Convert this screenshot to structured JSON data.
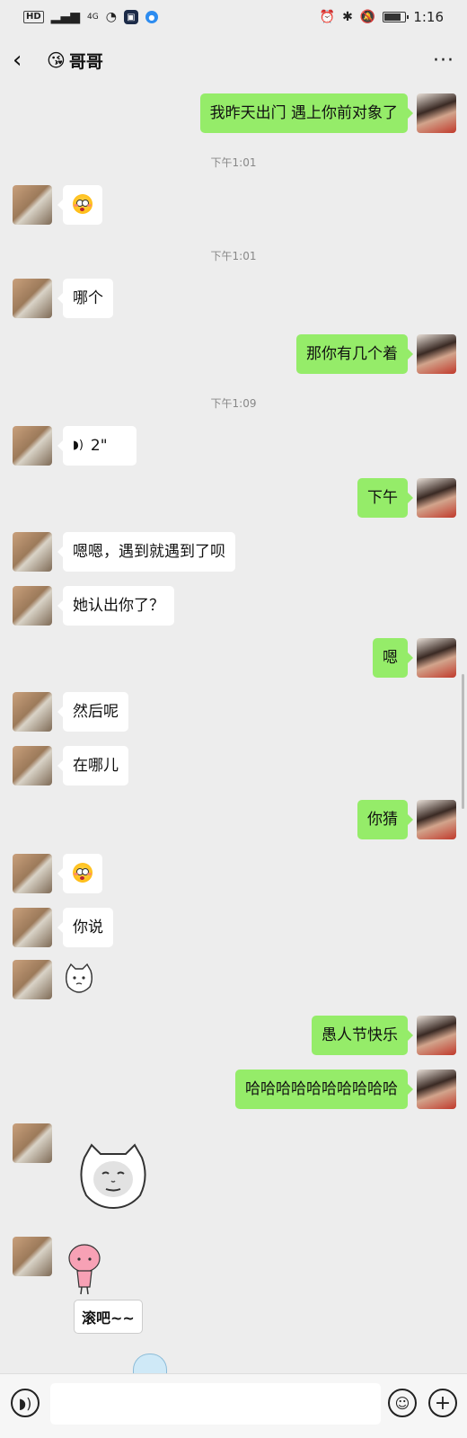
{
  "status_bar": {
    "hd": "HD",
    "signal": "4G",
    "time": "1:16",
    "battery_level": 0.85
  },
  "header": {
    "title_emoji": "😘",
    "title": "哥哥",
    "back_icon": "chevron-left-icon",
    "more_icon": "more-dots-icon"
  },
  "messages": {
    "m1": "我昨天出门 遇上你前对象了",
    "t1": "下午1:01",
    "t2": "下午1:01",
    "m3": "哪个",
    "m4": "那你有几个着",
    "t3": "下午1:09",
    "m5_voice": "2\"",
    "m6": "下午",
    "m7": "嗯嗯，遇到就遇到了呗",
    "m8": "她认出你了？",
    "m9": "嗯",
    "m10": "然后呢",
    "m11": "在哪儿",
    "m12": "你猜",
    "m14": "你说",
    "m16": "愚人节快乐",
    "m17": "哈哈哈哈哈哈哈哈哈哈",
    "sticker_text": "滚吧~~"
  },
  "input_bar": {
    "voice_icon": "voice-icon",
    "emoji_icon": "emoji-icon",
    "plus_icon": "plus-icon"
  }
}
